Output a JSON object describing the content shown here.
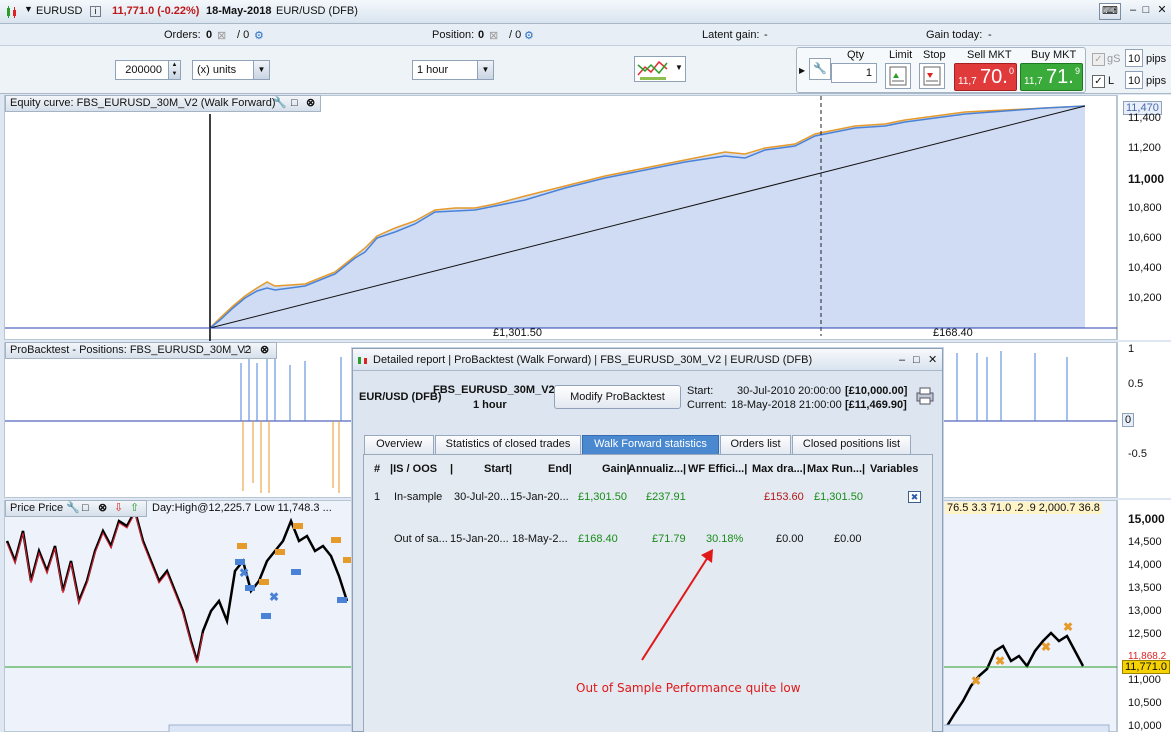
{
  "titlebar": {
    "instrument": "EURUSD",
    "price_change": "11,771.0 (-0.22%)",
    "date": "18-May-2018",
    "market": "EUR/USD (DFB)"
  },
  "inforow": {
    "orders_label": "Orders:",
    "orders_value": "0",
    "orders_total": "/ 0",
    "position_label": "Position:",
    "position_value": "0",
    "position_total": "/ 0",
    "latent_label": "Latent gain:",
    "latent_value": "-",
    "gain_today_label": "Gain today:",
    "gain_today_value": "-"
  },
  "controls": {
    "quantity": "200000",
    "units": "(x) units",
    "timeframe": "1 hour",
    "qty_label": "Qty",
    "qty_value": "1",
    "limit_label": "Limit",
    "stop_label": "Stop",
    "sell_label": "Sell MKT",
    "sell_prefix": "11,7",
    "sell_main": "70.",
    "sell_sup": "0",
    "buy_label": "Buy MKT",
    "buy_prefix": "11,7",
    "buy_main": "71.",
    "buy_sup": "9",
    "gs_label": "gS",
    "gs_pips": "10",
    "l_label": "L",
    "l_pips": "10",
    "pips_label": "pips",
    "sell_color": "#e03a3a",
    "buy_color": "#3aaa3a"
  },
  "equity_panel": {
    "title": "Equity curve: FBS_EURUSD_30M_V2 (Walk Forward)",
    "in_sample_gain": "£1,301.50",
    "out_sample_gain": "£168.40",
    "yticks": [
      "11,470",
      "11,400",
      "11,200",
      "11,000",
      "10,800",
      "10,600",
      "10,400",
      "10,200"
    ]
  },
  "positions_panel": {
    "title": "ProBacktest - Positions: FBS_EURUSD_30M_V2",
    "yticks": [
      "1",
      "0.5",
      "0",
      "-0.5"
    ]
  },
  "price_panel": {
    "title": "Price Price",
    "legend": "Day:High@12,225.7 Low 11,748.3 ...",
    "right_values": "76.5 3.3 71.0 .2 .9 2,000.7 36.8",
    "yticks": [
      "15,000",
      "14,500",
      "14,000",
      "13,500",
      "13,000",
      "12,500",
      "11,868.2",
      "11,771.0",
      "11,000",
      "10,500",
      "10,000"
    ]
  },
  "dialog": {
    "title": "Detailed report | ProBacktest (Walk Forward) | FBS_EURUSD_30M_V2 | EUR/USD (DFB)",
    "market": "EUR/USD (DFB)",
    "system": "FBS_EURUSD_30M_V2",
    "timeframe": "1 hour",
    "modify_button": "Modify ProBacktest",
    "start_label": "Start:",
    "start_date": "30-Jul-2010 20:00:00",
    "start_value": "[£10,000.00]",
    "current_label": "Current:",
    "current_date": "18-May-2018 21:00:00",
    "current_value": "[£11,469.90]",
    "tabs": [
      "Overview",
      "Statistics of closed trades",
      "Walk Forward statistics",
      "Orders list",
      "Closed positions list"
    ],
    "columns": [
      "#",
      "|IS / OOS",
      "|",
      "Start|",
      "End|",
      "Gain|",
      "Annualiz...|",
      "WF Effici...|",
      "Max dra...|",
      "Max Run...|",
      "Variables"
    ],
    "rows": [
      {
        "num": "1",
        "type": "In-sample",
        "start": "30-Jul-20...",
        "end": "15-Jan-20...",
        "gain": "£1,301.50",
        "annualized": "£237.91",
        "wf": "",
        "maxdd": "£153.60",
        "maxrun": "£1,301.50"
      },
      {
        "num": "",
        "type": "Out of sa...",
        "start": "15-Jan-20...",
        "end": "18-May-2...",
        "gain": "£168.40",
        "annualized": "£71.79",
        "wf": "30.18%",
        "maxdd": "£0.00",
        "maxrun": "£0.00"
      }
    ],
    "annotation": "Out of Sample Performance quite low"
  }
}
